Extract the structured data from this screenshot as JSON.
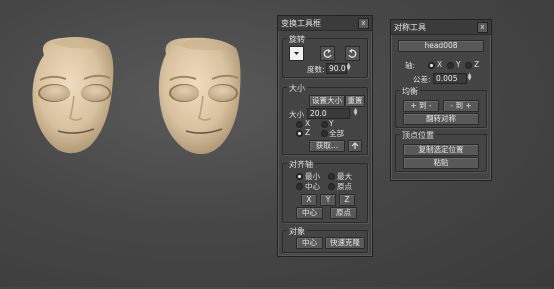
{
  "transform_toolbox": {
    "title": "变换工具框",
    "close_label": "x",
    "rotate": {
      "label": "旋转",
      "degrees_label": "度数:",
      "degrees_value": "90.0"
    },
    "scale": {
      "label": "大小",
      "set_size_label": "设置大小",
      "reset_label": "重置",
      "size_label": "大小",
      "size_value": "20.0",
      "axis_x": "X",
      "axis_y": "Y",
      "axis_z": "Z",
      "all_label": "全部",
      "get_label": "获取..."
    },
    "align": {
      "label": "对齐轴",
      "min_label": "最小",
      "max_label": "最大",
      "center_label": "中心",
      "origin_label": "原点",
      "x_btn": "X",
      "y_btn": "Y",
      "z_btn": "Z",
      "center_btn": "中心",
      "origin_btn": "原点"
    },
    "object": {
      "label": "对象",
      "center_btn": "中心",
      "quick_clone_btn": "快速克隆"
    }
  },
  "symmetry_tool": {
    "title": "对称工具",
    "close_label": "x",
    "object_btn": "head008",
    "axis_label": "轴:",
    "axis_x": "X",
    "axis_y": "Y",
    "axis_z": "Z",
    "tolerance_label": "公差:",
    "tolerance_value": "0.005",
    "balance": {
      "label": "均衡",
      "plus_to_minus": "+ 到 -",
      "minus_to_plus": "- 到 +",
      "flip_symmetry": "翻转对称"
    },
    "vertex_pos": {
      "label": "顶点位置",
      "copy_selected": "复制选定位置",
      "paste": "粘贴"
    }
  }
}
